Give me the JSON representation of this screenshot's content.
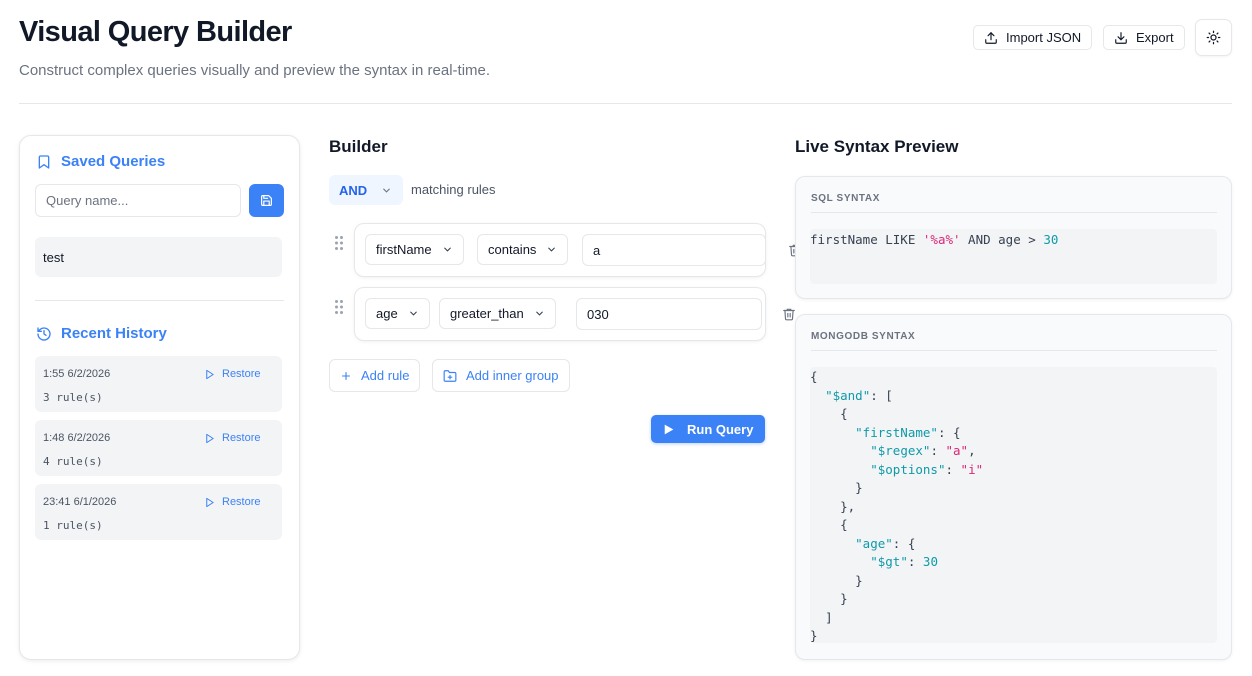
{
  "header": {
    "title": "Visual Query Builder",
    "subtitle": "Construct complex queries visually and preview the syntax in real-time.",
    "import_label": "Import JSON",
    "export_label": "Export"
  },
  "saved": {
    "heading": "Saved Queries",
    "placeholder": "Query name...",
    "items": [
      "test"
    ]
  },
  "history": {
    "heading": "Recent History",
    "restore_label": "Restore",
    "items": [
      {
        "time": "1:55 6/2/2026",
        "count": "3 rule(s)"
      },
      {
        "time": "1:48 6/2/2026",
        "count": "4 rule(s)"
      },
      {
        "time": "23:41 6/1/2026",
        "count": "1 rule(s)"
      }
    ]
  },
  "builder": {
    "heading": "Builder",
    "combinator": "AND",
    "matching": "matching rules",
    "rules": [
      {
        "field": "firstName",
        "operator": "contains",
        "value": "a"
      },
      {
        "field": "age",
        "operator": "greater_than",
        "value": "030"
      }
    ],
    "add_rule": "Add rule",
    "add_group": "Add inner group",
    "run": "Run Query"
  },
  "preview": {
    "heading": "Live Syntax Preview",
    "sql_label": "SQL SYNTAX",
    "sql": {
      "pre": "firstName LIKE ",
      "str": "'%a%'",
      "mid": " AND age > ",
      "num": "30"
    },
    "mongo_label": "MONGODB SYNTAX",
    "mongo": {
      "l1": "{",
      "k_and": "\"$and\"",
      "l2_rest": ": [",
      "l3": "{",
      "k_first": "\"firstName\"",
      "l4_rest": ": {",
      "k_regex": "\"$regex\"",
      "v_regex": "\"a\"",
      "k_opts": "\"$options\"",
      "v_opts": "\"i\"",
      "l7": "}",
      "l8": "},",
      "l9": "{",
      "k_age": "\"age\"",
      "l10_rest": ": {",
      "k_gt": "\"$gt\"",
      "v_gt": "30",
      "l12": "}",
      "l13": "}",
      "l14": "]",
      "l15": "}"
    }
  },
  "colors": {
    "accent": "#3b82f6",
    "string": "#db2777",
    "number": "#0f9aa8"
  }
}
